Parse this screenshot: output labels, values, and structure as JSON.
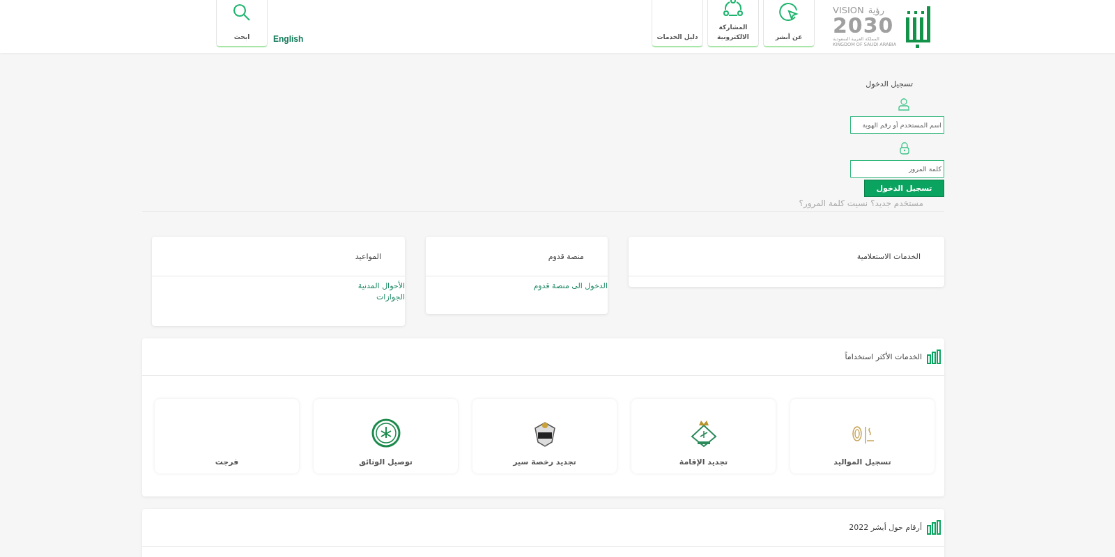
{
  "header": {
    "vision_logo": {
      "word_en": "VISION",
      "word_ar": "رؤية",
      "year": "2030",
      "country_ar": "المملكة العربية السعودية",
      "country_en": "KINGDOM OF SAUDI ARABIA"
    },
    "nav": [
      {
        "label": "عن أبشر"
      },
      {
        "label": "المشاركة الالكترونية"
      },
      {
        "label": "دليل الخدمات"
      }
    ],
    "language": "English",
    "search": {
      "label": "ابحث"
    }
  },
  "login": {
    "title": "تسجيل الدخول",
    "username": {
      "placeholder": "اسم المستخدم أو رقم الهوية"
    },
    "password": {
      "placeholder": "كلمة المرور"
    },
    "button": "تسجيل الدخول",
    "links": [
      "مستخدم جديد؟",
      "نسيت كلمة المرور؟"
    ]
  },
  "cards": [
    {
      "title": "الخدمات الاستعلامية"
    },
    {
      "title": "منصة قدوم",
      "links": [
        "الدخول الى منصة قدوم"
      ]
    },
    {
      "title": "المواعيد",
      "links": [
        "الأحوال المدنية",
        "الجوازات"
      ]
    }
  ],
  "most_used": {
    "title": "الخدمات الأكثر استخداماً",
    "services": [
      {
        "label": "تسجيل المواليد"
      },
      {
        "label": "تجديد الإقامة"
      },
      {
        "label": "تجديد رخصة سير"
      },
      {
        "label": "توصيل الوثائق"
      },
      {
        "label": "فرجت"
      }
    ]
  },
  "stats": {
    "title": "أرقام حول أبشر 2022"
  }
}
